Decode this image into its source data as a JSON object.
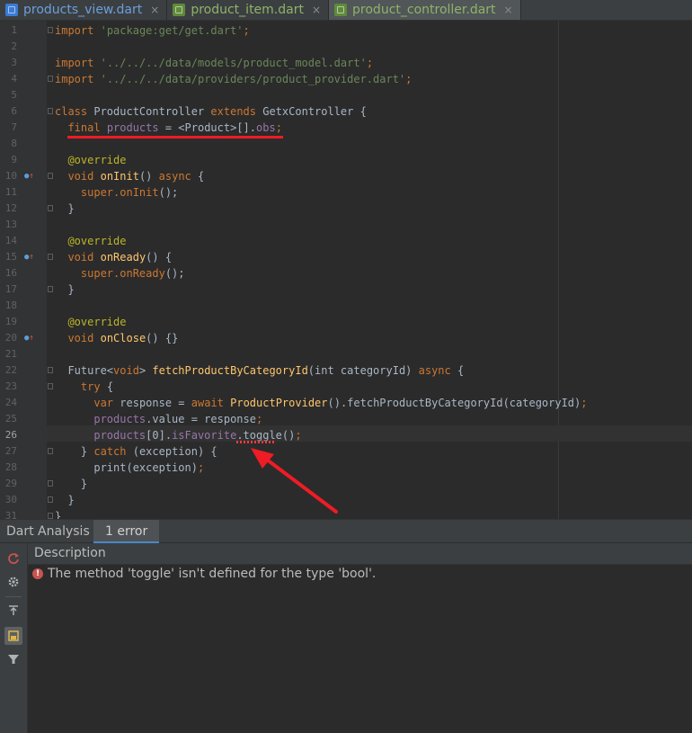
{
  "tabs": [
    {
      "label": "products_view.dart",
      "close": "×",
      "icon_color": "#3a7bd5"
    },
    {
      "label": "product_item.dart",
      "close": "×",
      "icon_color": "#5f8a3a"
    },
    {
      "label": "product_controller.dart",
      "close": "×",
      "icon_color": "#5f8a3a",
      "active": true
    }
  ],
  "editor": {
    "lines": [
      {
        "n": "1"
      },
      {
        "n": "2"
      },
      {
        "n": "3"
      },
      {
        "n": "4"
      },
      {
        "n": "5"
      },
      {
        "n": "6"
      },
      {
        "n": "7"
      },
      {
        "n": "8"
      },
      {
        "n": "9"
      },
      {
        "n": "10"
      },
      {
        "n": "11"
      },
      {
        "n": "12"
      },
      {
        "n": "13"
      },
      {
        "n": "14"
      },
      {
        "n": "15"
      },
      {
        "n": "16"
      },
      {
        "n": "17"
      },
      {
        "n": "18"
      },
      {
        "n": "19"
      },
      {
        "n": "20"
      },
      {
        "n": "21"
      },
      {
        "n": "22"
      },
      {
        "n": "23"
      },
      {
        "n": "24"
      },
      {
        "n": "25"
      },
      {
        "n": "26"
      },
      {
        "n": "27"
      },
      {
        "n": "28"
      },
      {
        "n": "29"
      },
      {
        "n": "30"
      },
      {
        "n": "31"
      }
    ],
    "code": {
      "l1_kw": "import",
      "l1_str": "'package:get/get.dart'",
      "l1_end": ";",
      "l3_kw": "import",
      "l3_str": "'../../../data/models/product_model.dart'",
      "l3_end": ";",
      "l4_kw": "import",
      "l4_str": "'../../../data/providers/product_provider.dart'",
      "l4_end": ";",
      "l6_kw1": "class",
      "l6_name": "ProductController",
      "l6_kw2": "extends",
      "l6_rest": "GetxController {",
      "l7_kw": "final",
      "l7_field": "products",
      "l7_mid": "= <Product>[].",
      "l7_obs": "obs",
      "l7_end": ";",
      "l9_ann": "@override",
      "l10_kw": "void",
      "l10_fn": "onInit",
      "l10_mid": "()",
      "l10_kw2": "async",
      "l10_end": "{",
      "l11_text": "super.onInit",
      "l11_end": "();",
      "l12_text": "}",
      "l14_ann": "@override",
      "l15_kw": "void",
      "l15_fn": "onReady",
      "l15_end": "() {",
      "l16_text": "super.onReady",
      "l16_end": "();",
      "l17_text": "}",
      "l19_ann": "@override",
      "l20_kw": "void",
      "l20_fn": "onClose",
      "l20_end": "() {}",
      "l22_a": "Future<",
      "l22_kw": "void",
      "l22_b": ">",
      "l22_fn": "fetchProductByCategoryId",
      "l22_c": "(int categoryId)",
      "l22_kw2": "async",
      "l22_d": "{",
      "l23_kw": "try",
      "l23_end": "{",
      "l24_kw": "var",
      "l24_a": "response =",
      "l24_kw2": "await",
      "l24_fn": "ProductProvider",
      "l24_b": "().fetchProductByCategoryId(categoryId)",
      "l24_end": ";",
      "l25_field": "products",
      "l25_a": ".value = response",
      "l25_end": ";",
      "l26_field": "products",
      "l26_a": "[0].",
      "l26_field2": "isFavorite",
      "l26_b": ".",
      "l26_err": "toggle",
      "l26_c": "()",
      "l26_end": ";",
      "l27_a": "}",
      "l27_kw": "catch",
      "l27_b": "(exception) {",
      "l28_a": "print(exception)",
      "l28_end": ";",
      "l29_text": "}",
      "l30_text": "}",
      "l31_text": "}"
    }
  },
  "panel": {
    "title": "Dart Analysis",
    "tab_label": "1 error",
    "column_header": "Description",
    "toolbar_icons": [
      "refresh-icon",
      "settings-icon",
      "autoscroll-icon",
      "group-by-file-icon",
      "filter-icon"
    ],
    "errors": [
      {
        "icon": "!",
        "message": "The method 'toggle' isn't defined for the type 'bool'."
      }
    ]
  },
  "colors": {
    "keyword": "#cc7832",
    "string": "#6a8759",
    "annotation": "#bbb529",
    "function": "#ffc66d",
    "field": "#9876aa",
    "error": "#c75450",
    "accent": "#4a88c7"
  }
}
